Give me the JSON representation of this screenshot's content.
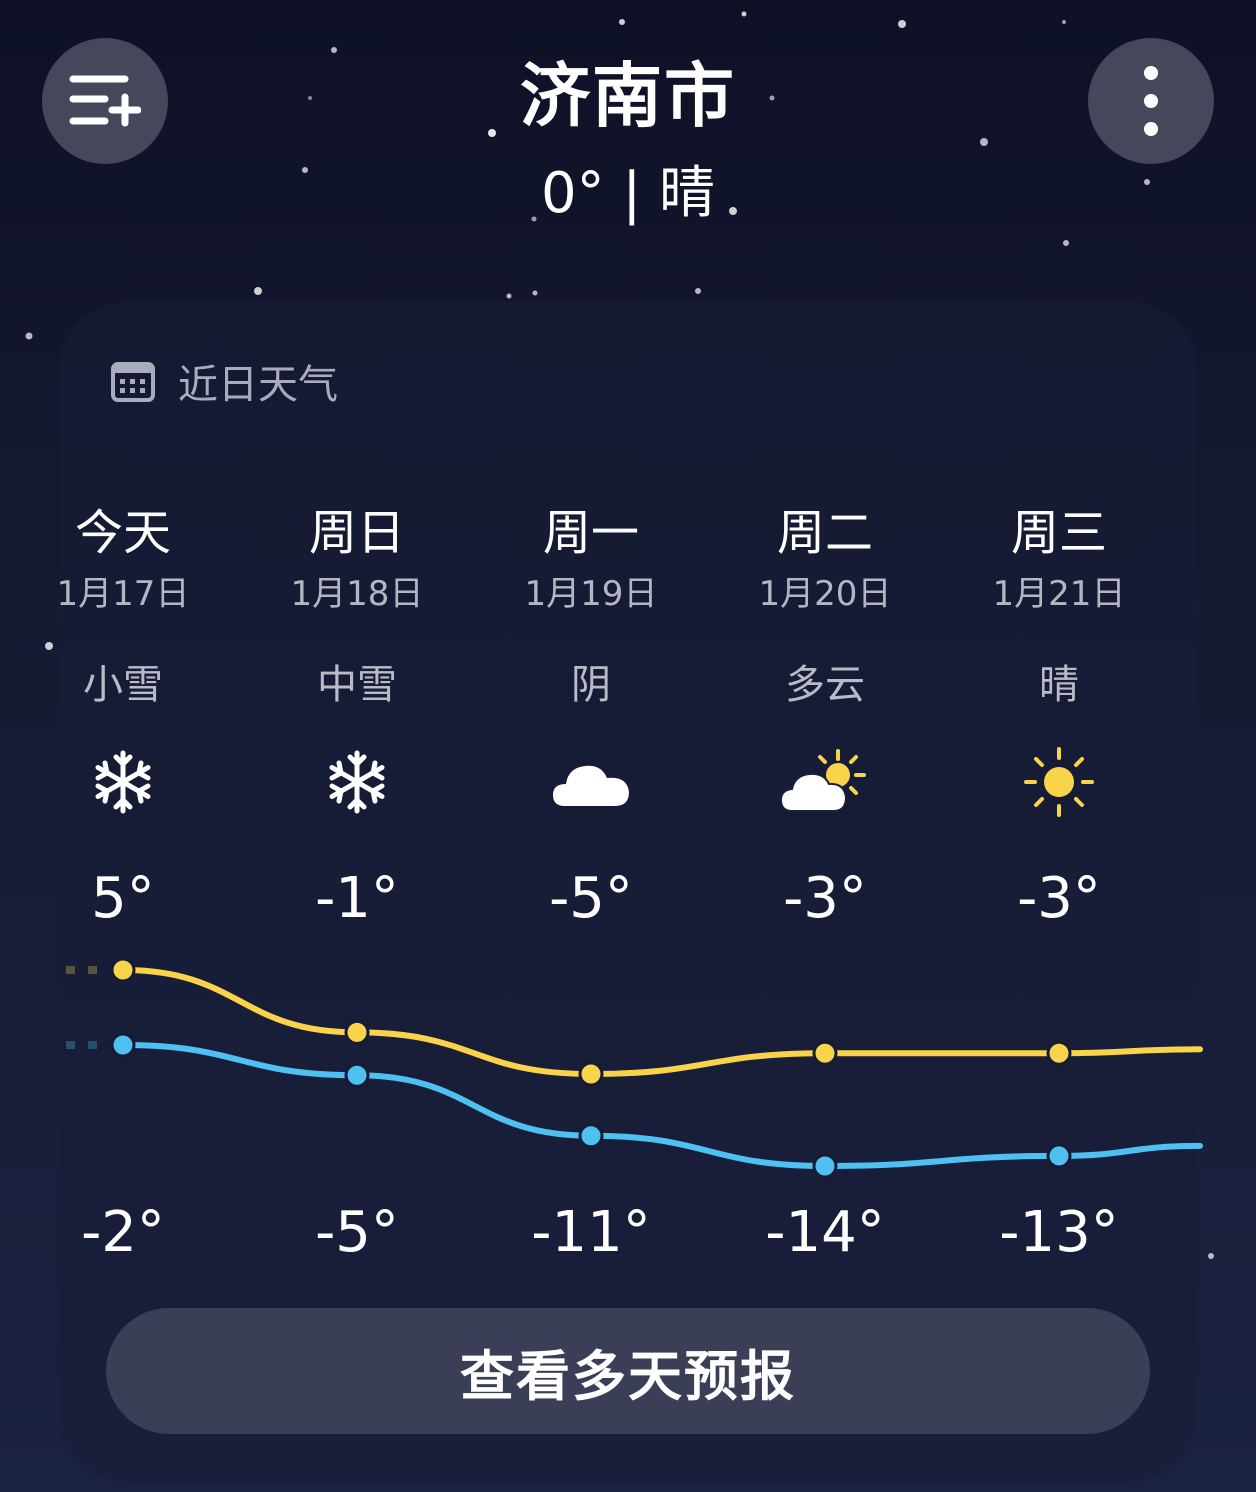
{
  "header": {
    "city": "济南市",
    "current": "0° | 晴",
    "menu_icon": "list-add-icon",
    "more_icon": "more-vertical-icon"
  },
  "section": {
    "title": "近日天气",
    "icon": "calendar-icon"
  },
  "days": [
    {
      "day": "今天",
      "date": "1月17日",
      "cond": "小雪",
      "icon": "snowflake-icon",
      "high": "5°",
      "low": "-2°"
    },
    {
      "day": "周日",
      "date": "1月18日",
      "cond": "中雪",
      "icon": "snowflake-icon",
      "high": "-1°",
      "low": "-5°"
    },
    {
      "day": "周一",
      "date": "1月19日",
      "cond": "阴",
      "icon": "cloud-icon",
      "high": "-5°",
      "low": "-11°"
    },
    {
      "day": "周二",
      "date": "1月20日",
      "cond": "多云",
      "icon": "partly-cloudy-icon",
      "high": "-3°",
      "low": "-14°"
    },
    {
      "day": "周三",
      "date": "1月21日",
      "cond": "晴",
      "icon": "sun-icon",
      "high": "-3°",
      "low": "-13°"
    }
  ],
  "chart_data": {
    "type": "line",
    "categories": [
      "1月17日",
      "1月18日",
      "1月19日",
      "1月20日",
      "1月21日"
    ],
    "series": [
      {
        "values": [
          5,
          -1,
          -5,
          -3,
          -3
        ],
        "color": "#f9d34a"
      },
      {
        "values": [
          -2,
          -5,
          -11,
          -14,
          -13
        ],
        "color": "#4fc0f2"
      }
    ]
  },
  "forecast_button": "查看多天预报",
  "colors": {
    "high": "#f9d34a",
    "low": "#4fc0f2",
    "sun": "#f9d34a",
    "background": "#12162e"
  }
}
